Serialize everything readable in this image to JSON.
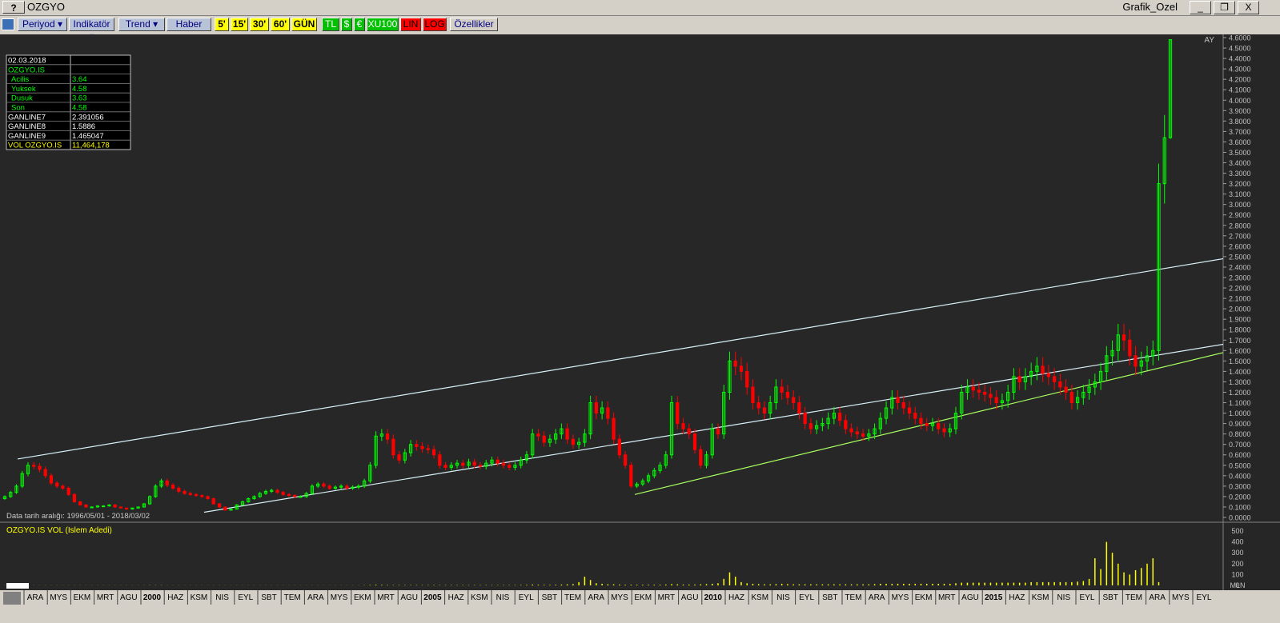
{
  "window": {
    "help_label": "?",
    "symbol": "OZGYO",
    "title_right": "Grafik_Ozel",
    "minimize": "_",
    "restore": "❐",
    "close": "X"
  },
  "toolbar": {
    "buttons": [
      {
        "label": "Periyod ▾",
        "style": "menu"
      },
      {
        "label": "Indikatör ▾",
        "style": "menu"
      },
      {
        "label": "Trend ▾",
        "style": "menu"
      },
      {
        "label": "Haber",
        "style": "menu"
      },
      {
        "label": "5'",
        "style": "yel"
      },
      {
        "label": "15'",
        "style": "yel"
      },
      {
        "label": "30'",
        "style": "yel"
      },
      {
        "label": "60'",
        "style": "yel"
      },
      {
        "label": "GÜN",
        "style": "yel"
      },
      {
        "label": "TL",
        "style": "grn"
      },
      {
        "label": "$",
        "style": "grn"
      },
      {
        "label": "€",
        "style": "grn"
      },
      {
        "label": "XU100",
        "style": "grn"
      },
      {
        "label": "LIN",
        "style": "red"
      },
      {
        "label": "LOG",
        "style": "red"
      },
      {
        "label": "Özellikler",
        "style": "plain"
      }
    ]
  },
  "colors": {
    "background": "#272727",
    "up_candle": "#00ff00",
    "down_candle": "#ff0000",
    "volume": "#ffff00",
    "channel_line": "#ffffff",
    "trend_line": "#a8ff60",
    "axis_text": "#c0c0c0"
  },
  "info_box": {
    "date": "02.03.2018",
    "symbol": "OZGYO.IS",
    "rows": [
      {
        "label": "Acilis",
        "value": "3.64",
        "color": "#00ff00"
      },
      {
        "label": "Yuksek",
        "value": "4.58",
        "color": "#00ff00"
      },
      {
        "label": "Dusuk",
        "value": "3.63",
        "color": "#00ff00"
      },
      {
        "label": "Son",
        "value": "4.58",
        "color": "#00ff00"
      },
      {
        "label": "GANLINE7",
        "value": "2.391056",
        "color": "#ffffff"
      },
      {
        "label": "GANLINE8",
        "value": "1.5886",
        "color": "#ffffff"
      },
      {
        "label": "GANLINE9",
        "value": "1.465047",
        "color": "#ffffff"
      },
      {
        "label": "VOL OZGYO.IS",
        "value": "11,464,178",
        "color": "#ffff00"
      }
    ]
  },
  "period_label": "AY",
  "date_range_text": "Data tarih aralığı: 1996/05/01 - 2018/03/02",
  "volume_panel": {
    "title": "OZGYO.IS VOL (Islem Adedi)",
    "unit": "MLN",
    "ticks": [
      "500",
      "400",
      "300",
      "200",
      "100",
      "0"
    ]
  },
  "x_axis_labels": [
    "ARA",
    "MYS",
    "EKM",
    "MRT",
    "AGU",
    "2000",
    "HAZ",
    "KSM",
    "NIS",
    "EYL",
    "SBT",
    "TEM",
    "ARA",
    "MYS",
    "EKM",
    "MRT",
    "AGU",
    "2005",
    "HAZ",
    "KSM",
    "NIS",
    "EYL",
    "SBT",
    "TEM",
    "ARA",
    "MYS",
    "EKM",
    "MRT",
    "AGU",
    "2010",
    "HAZ",
    "KSM",
    "NIS",
    "EYL",
    "SBT",
    "TEM",
    "ARA",
    "MYS",
    "EKM",
    "MRT",
    "AGU",
    "2015",
    "HAZ",
    "KSM",
    "NIS",
    "EYL",
    "SBT",
    "TEM",
    "ARA",
    "MYS",
    "EYL"
  ],
  "chart_data": {
    "type": "candlestick",
    "title": "OZGYO",
    "period": "AY",
    "y_ticks": [
      "4.6000",
      "4.5000",
      "4.4000",
      "4.3000",
      "4.2000",
      "4.1000",
      "4.0000",
      "3.9000",
      "3.8000",
      "3.7000",
      "3.6000",
      "3.5000",
      "3.4000",
      "3.3000",
      "3.2000",
      "3.1000",
      "3.0000",
      "2.9000",
      "2.8000",
      "2.7000",
      "2.6000",
      "2.5000",
      "2.4000",
      "2.3000",
      "2.2000",
      "2.1000",
      "2.0000",
      "1.9000",
      "1.8000",
      "1.7000",
      "1.6000",
      "1.5000",
      "1.4000",
      "1.3000",
      "1.2000",
      "1.1000",
      "1.0000",
      "0.9000",
      "0.8000",
      "0.7000",
      "0.6000",
      "0.5000",
      "0.4000",
      "0.3000",
      "0.2000",
      "0.1000",
      "0.0000"
    ],
    "ylim": [
      0,
      4.6
    ],
    "closes": [
      0.2,
      0.24,
      0.3,
      0.42,
      0.5,
      0.49,
      0.46,
      0.4,
      0.33,
      0.3,
      0.28,
      0.22,
      0.15,
      0.12,
      0.1,
      0.1,
      0.11,
      0.11,
      0.12,
      0.1,
      0.09,
      0.08,
      0.09,
      0.1,
      0.13,
      0.2,
      0.3,
      0.35,
      0.31,
      0.28,
      0.25,
      0.23,
      0.22,
      0.21,
      0.2,
      0.18,
      0.13,
      0.1,
      0.07,
      0.08,
      0.12,
      0.15,
      0.18,
      0.2,
      0.23,
      0.25,
      0.26,
      0.24,
      0.22,
      0.21,
      0.2,
      0.2,
      0.23,
      0.3,
      0.32,
      0.3,
      0.28,
      0.29,
      0.3,
      0.28,
      0.29,
      0.3,
      0.35,
      0.5,
      0.78,
      0.8,
      0.75,
      0.6,
      0.55,
      0.62,
      0.7,
      0.68,
      0.66,
      0.65,
      0.6,
      0.5,
      0.48,
      0.5,
      0.52,
      0.5,
      0.53,
      0.5,
      0.49,
      0.52,
      0.55,
      0.52,
      0.5,
      0.48,
      0.5,
      0.55,
      0.6,
      0.8,
      0.78,
      0.72,
      0.75,
      0.8,
      0.85,
      0.75,
      0.7,
      0.72,
      0.8,
      1.1,
      1.0,
      1.05,
      0.95,
      0.75,
      0.6,
      0.5,
      0.3,
      0.32,
      0.35,
      0.4,
      0.45,
      0.5,
      0.6,
      1.1,
      0.9,
      0.85,
      0.8,
      0.65,
      0.5,
      0.6,
      0.85,
      0.8,
      1.2,
      1.5,
      1.45,
      1.4,
      1.25,
      1.1,
      1.05,
      1.0,
      1.1,
      1.25,
      1.2,
      1.15,
      1.1,
      1.0,
      0.9,
      0.85,
      0.88,
      0.9,
      0.95,
      1.0,
      0.93,
      0.85,
      0.82,
      0.8,
      0.78,
      0.8,
      0.85,
      0.95,
      1.05,
      1.15,
      1.1,
      1.05,
      1.0,
      0.95,
      0.9,
      0.88,
      0.9,
      0.85,
      0.82,
      0.85,
      1.0,
      1.2,
      1.25,
      1.22,
      1.2,
      1.18,
      1.15,
      1.1,
      1.12,
      1.2,
      1.35,
      1.3,
      1.35,
      1.4,
      1.45,
      1.38,
      1.35,
      1.3,
      1.25,
      1.2,
      1.1,
      1.15,
      1.2,
      1.25,
      1.3,
      1.4,
      1.55,
      1.6,
      1.75,
      1.7,
      1.55,
      1.45,
      1.5,
      1.55,
      1.6,
      3.2,
      3.64,
      4.58
    ],
    "volume_million": [
      1,
      1,
      1,
      2,
      2,
      1,
      1,
      1,
      1,
      1,
      1,
      1,
      1,
      1,
      1,
      1,
      1,
      1,
      1,
      1,
      1,
      1,
      1,
      1,
      1,
      2,
      2,
      2,
      1,
      1,
      1,
      1,
      1,
      1,
      1,
      1,
      1,
      1,
      1,
      1,
      1,
      1,
      1,
      1,
      1,
      1,
      1,
      1,
      1,
      1,
      1,
      1,
      1,
      1,
      1,
      1,
      1,
      1,
      1,
      1,
      1,
      1,
      2,
      4,
      6,
      5,
      4,
      3,
      3,
      3,
      3,
      3,
      3,
      3,
      3,
      3,
      3,
      3,
      3,
      3,
      3,
      3,
      3,
      3,
      3,
      3,
      3,
      3,
      3,
      4,
      5,
      8,
      6,
      5,
      5,
      6,
      8,
      10,
      12,
      30,
      80,
      50,
      20,
      15,
      10,
      10,
      8,
      6,
      6,
      6,
      6,
      6,
      6,
      6,
      8,
      12,
      10,
      8,
      8,
      8,
      10,
      12,
      15,
      20,
      60,
      120,
      80,
      30,
      20,
      15,
      12,
      10,
      10,
      12,
      15,
      12,
      10,
      10,
      10,
      10,
      10,
      10,
      10,
      10,
      10,
      10,
      10,
      10,
      10,
      10,
      12,
      15,
      15,
      15,
      15,
      15,
      15,
      15,
      15,
      15,
      15,
      15,
      15,
      15,
      20,
      25,
      25,
      25,
      25,
      25,
      25,
      25,
      25,
      25,
      25,
      25,
      25,
      30,
      30,
      30,
      30,
      30,
      30,
      30,
      30,
      35,
      40,
      60,
      250,
      150,
      400,
      300,
      200,
      120,
      100,
      140,
      160,
      200,
      250,
      30
    ]
  }
}
